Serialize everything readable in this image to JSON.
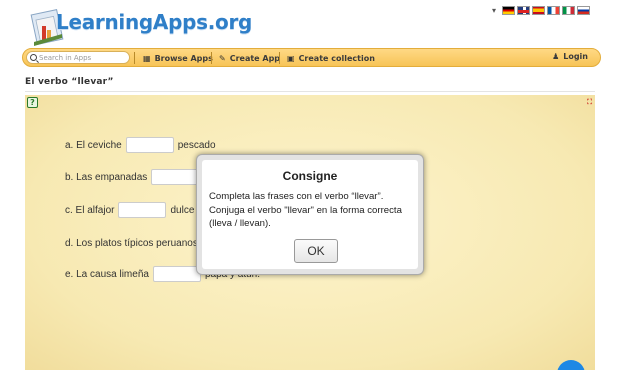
{
  "site": {
    "logo_text": "LearningApps.org"
  },
  "languages": {
    "selector_arrow": "▾",
    "flags": [
      "de",
      "gb",
      "es",
      "fr",
      "it",
      "ru"
    ]
  },
  "nav": {
    "search_placeholder": "Search in Apps",
    "browse_label": "Browse Apps",
    "create_app_label": "Create App",
    "create_collection_label": "Create collection",
    "login_label": "Login"
  },
  "page": {
    "title": "El verbo “llevar”"
  },
  "exercise": {
    "sentences": [
      {
        "before": "a. El ceviche",
        "after": "pescado"
      },
      {
        "before": "b. Las empanadas",
        "after": ""
      },
      {
        "before": "c. El alfajor",
        "after": "dulce"
      },
      {
        "before": "d. Los platos típicos peruanos",
        "after": ""
      },
      {
        "before": "e. La causa limeña",
        "after": "papa y atún."
      }
    ]
  },
  "modal": {
    "title": "Consigne",
    "body": "Completa las frases con el verbo “llevar”. Conjuga el verbo \"llevar\" en la forma correcta (lleva / llevan).",
    "ok_label": "OK"
  },
  "colors": {
    "nav_bg": "#f7c457",
    "logo_blue": "#2f7fc8",
    "app_bg": "#f7e9b2",
    "fab_blue": "#1e88e5"
  }
}
